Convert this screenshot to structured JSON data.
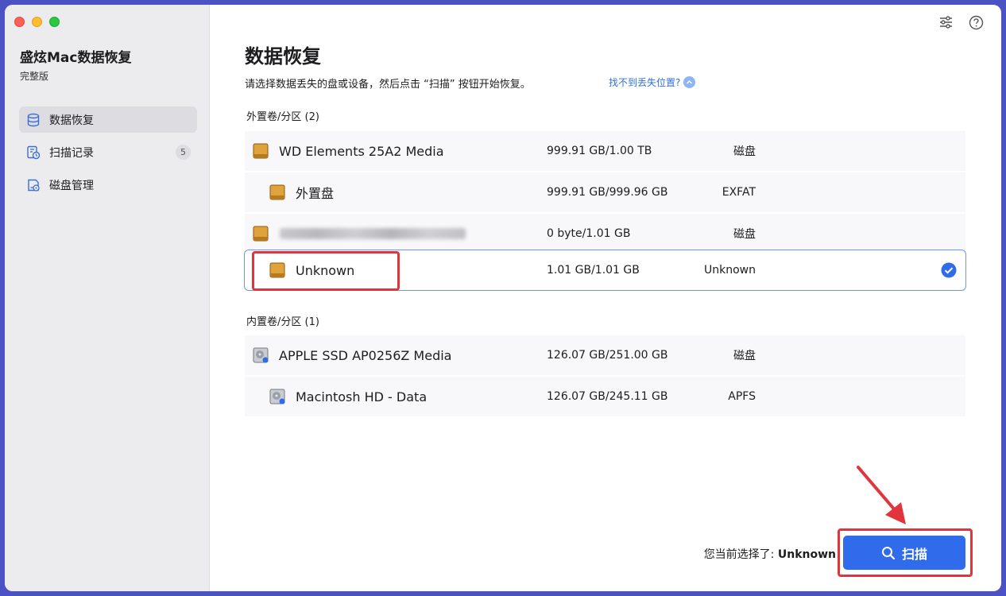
{
  "sidebar": {
    "app_name": "盛炫Mac数据恢复",
    "edition": "完整版",
    "items": [
      {
        "label": "数据恢复",
        "icon": "database-icon",
        "active": true
      },
      {
        "label": "扫描记录",
        "icon": "history-icon",
        "badge": "5"
      },
      {
        "label": "磁盘管理",
        "icon": "disk-manage-icon"
      }
    ]
  },
  "header": {
    "title": "数据恢复",
    "subtitle": "请选择数据丢失的盘或设备，然后点击 “扫描” 按钮开始恢复。",
    "help_link": "找不到丢失位置?"
  },
  "external": {
    "label": "外置卷/分区 (2)",
    "rows": [
      {
        "name": "WD Elements 25A2 Media",
        "size": "999.91 GB/1.00 TB",
        "type": "磁盘",
        "indent": false
      },
      {
        "name": "外置盘",
        "size": "999.91 GB/999.96 GB",
        "type": "EXFAT",
        "indent": true
      },
      {
        "name": "",
        "size": "0 byte/1.01 GB",
        "type": "磁盘",
        "indent": false,
        "blurred": true
      },
      {
        "name": "Unknown",
        "size": "1.01 GB/1.01 GB",
        "type": "Unknown",
        "indent": true,
        "selected": true
      }
    ]
  },
  "internal": {
    "label": "内置卷/分区 (1)",
    "rows": [
      {
        "name": "APPLE SSD AP0256Z Media",
        "size": "126.07 GB/251.00 GB",
        "type": "磁盘",
        "indent": false
      },
      {
        "name": "Macintosh HD - Data",
        "size": "126.07 GB/245.11 GB",
        "type": "APFS",
        "indent": true
      }
    ]
  },
  "footer": {
    "status_prefix": "您当前选择了: ",
    "status_value": "Unknown",
    "scan_label": "扫描"
  },
  "colors": {
    "accent": "#2f6bea",
    "highlight": "#e0353d",
    "sidebar_bg": "#ececef"
  }
}
